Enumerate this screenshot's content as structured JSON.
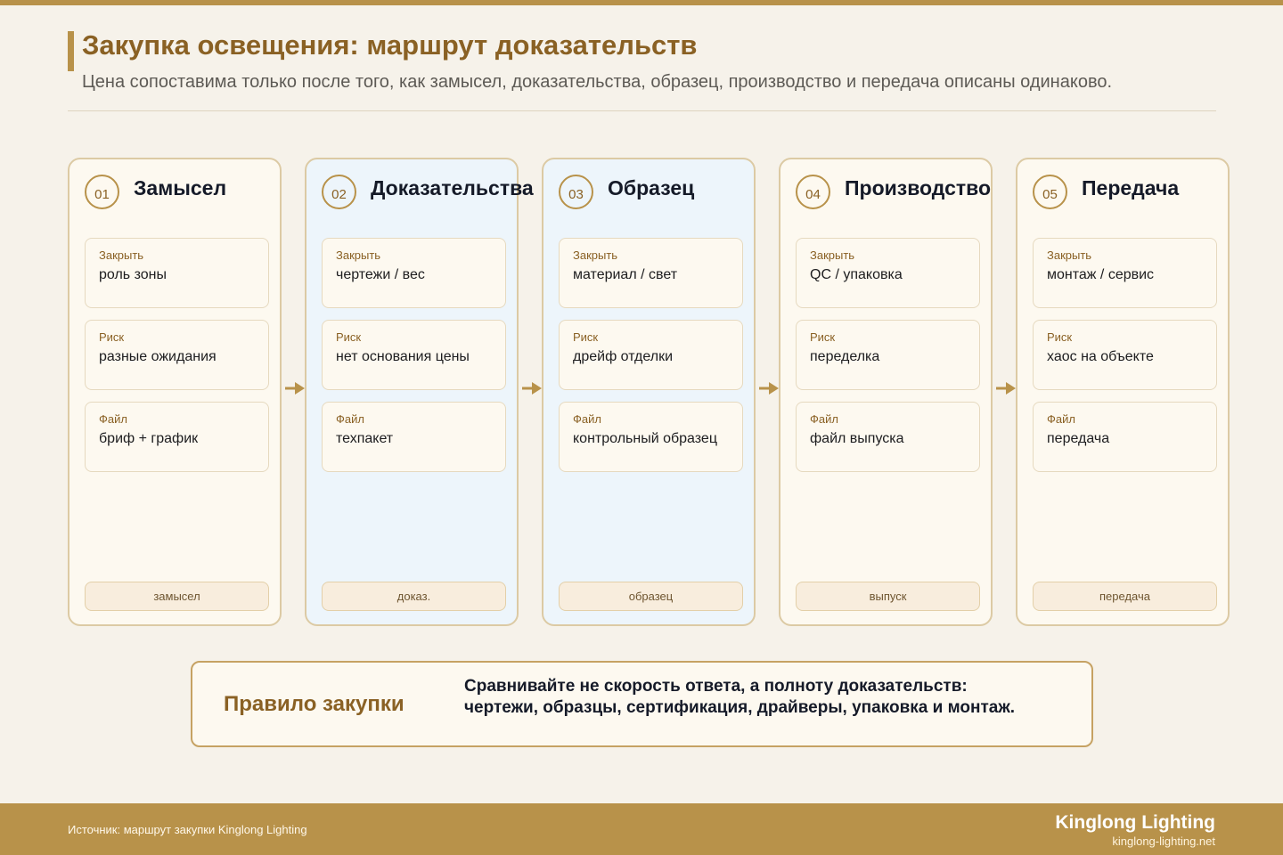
{
  "header": {
    "title": "Закупка освещения: маршрут доказательств",
    "subtitle": "Цена сопоставима только после того, как замысел, доказательства, образец, производство и передача описаны одинаково."
  },
  "stages": [
    {
      "number": "01",
      "title": "Замысел",
      "highlight": false,
      "fields": [
        {
          "label": "Закрыть",
          "value": "роль зоны"
        },
        {
          "label": "Риск",
          "value": "разные ожидания"
        },
        {
          "label": "Файл",
          "value": "бриф + график"
        }
      ],
      "pill": "замысел"
    },
    {
      "number": "02",
      "title": "Доказательства",
      "highlight": true,
      "fields": [
        {
          "label": "Закрыть",
          "value": "чертежи / вес"
        },
        {
          "label": "Риск",
          "value": "нет основания цены"
        },
        {
          "label": "Файл",
          "value": "техпакет"
        }
      ],
      "pill": "доказ."
    },
    {
      "number": "03",
      "title": "Образец",
      "highlight": true,
      "fields": [
        {
          "label": "Закрыть",
          "value": "материал / свет"
        },
        {
          "label": "Риск",
          "value": "дрейф отделки"
        },
        {
          "label": "Файл",
          "value": "контрольный образец"
        }
      ],
      "pill": "образец"
    },
    {
      "number": "04",
      "title": "Производство",
      "highlight": false,
      "fields": [
        {
          "label": "Закрыть",
          "value": "QC / упаковка"
        },
        {
          "label": "Риск",
          "value": "переделка"
        },
        {
          "label": "Файл",
          "value": "файл выпуска"
        }
      ],
      "pill": "выпуск"
    },
    {
      "number": "05",
      "title": "Передача",
      "highlight": false,
      "fields": [
        {
          "label": "Закрыть",
          "value": "монтаж / сервис"
        },
        {
          "label": "Риск",
          "value": "хаос на объекте"
        },
        {
          "label": "Файл",
          "value": "передача"
        }
      ],
      "pill": "передача"
    }
  ],
  "rule": {
    "title": "Правило закупки",
    "text": "Сравнивайте не скорость ответа, а полноту доказательств: чертежи, образцы, сертификация, драйверы, упаковка и монтаж."
  },
  "footer": {
    "source": "Источник: маршрут закупки Kinglong Lighting",
    "brand": "Kinglong Lighting",
    "site": "kinglong-lighting.net"
  },
  "colors": {
    "accent": "#b8924a",
    "title": "#8a6124",
    "background": "#f6f2ea",
    "card": "#fdf9f0",
    "card_highlight": "#edf5fb"
  },
  "icons": {
    "connector": "arrow-right-icon"
  }
}
